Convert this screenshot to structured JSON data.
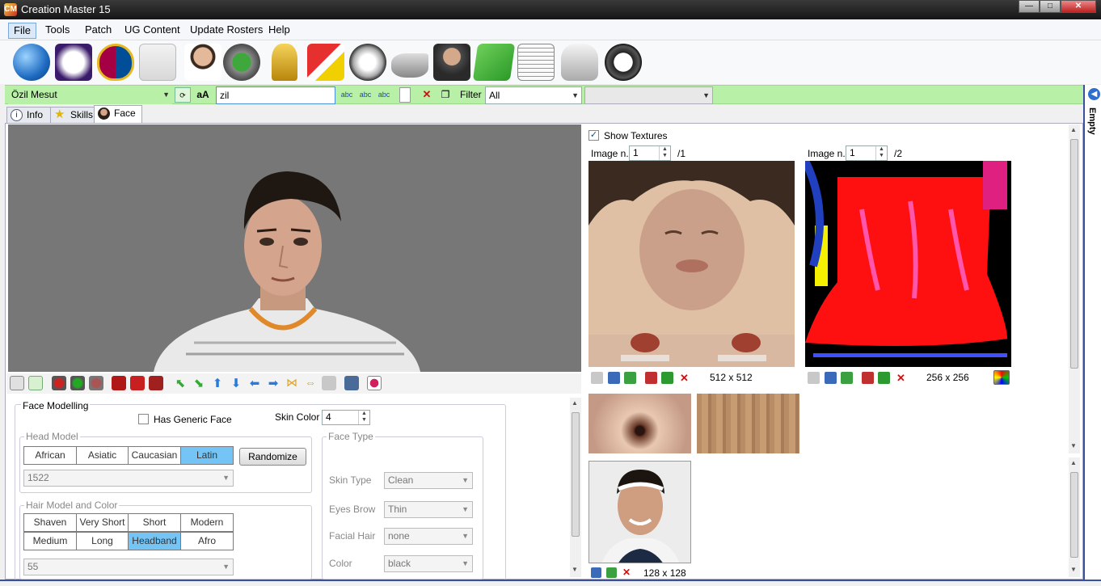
{
  "window": {
    "title": "Creation Master 15",
    "min": "—",
    "max": "□",
    "close": "✕",
    "app_icon": "CM"
  },
  "menu": [
    "File",
    "Tools",
    "Patch",
    "UG Content",
    "Update Rosters",
    "Help"
  ],
  "toolbar_icons": [
    "globe-icon",
    "premier-league-icon",
    "fc-barcelona-icon",
    "kit-icon",
    "player-icon",
    "stadium-icon",
    "trophy-icon",
    "referee-card-icon",
    "ball-icon",
    "boots-icon",
    "manager-icon",
    "pitch-icon",
    "newspaper-icon",
    "gloves-icon",
    "headphones-icon"
  ],
  "search": {
    "player": "Özil Mesut",
    "case_label": "aA",
    "query": "zil",
    "filter_label": "Filter",
    "filter_value": "All",
    "secondary_value": ""
  },
  "right_panel": {
    "label": "Empty"
  },
  "tabs": [
    {
      "label": "Info",
      "icon": "info-icon"
    },
    {
      "label": "Skills",
      "icon": "star-icon"
    },
    {
      "label": "Face",
      "icon": "face-icon"
    }
  ],
  "face": {
    "section_title": "Face Modelling",
    "generic_face_label": "Has Generic Face",
    "skin_color_label": "Skin Color",
    "skin_color_value": "4",
    "head_model": {
      "title": "Head Model",
      "options": [
        "African",
        "Asiatic",
        "Caucasian",
        "Latin"
      ],
      "selected": "Latin",
      "randomize": "Randomize",
      "value": "1522"
    },
    "hair": {
      "title": "Hair Model and Color",
      "options": [
        "Shaven",
        "Very Short",
        "Short",
        "Modern",
        "Medium",
        "Long",
        "Headband",
        "Afro"
      ],
      "selected": "Headband",
      "value": "55"
    },
    "face_type": {
      "title": "Face Type",
      "fields": [
        {
          "label": "Skin Type",
          "value": "Clean"
        },
        {
          "label": "Eyes Brow",
          "value": "Thin"
        },
        {
          "label": "Facial Hair",
          "value": "none"
        },
        {
          "label": "Color",
          "value": "black"
        }
      ]
    }
  },
  "textures": {
    "show_label": "Show Textures",
    "left": {
      "label": "Image n.",
      "value": "1",
      "total": "/1",
      "size": "512 x 512"
    },
    "right": {
      "label": "Image n.",
      "value": "1",
      "total": "/2",
      "size": "256 x 256"
    },
    "photo_size": "128 x 128"
  }
}
